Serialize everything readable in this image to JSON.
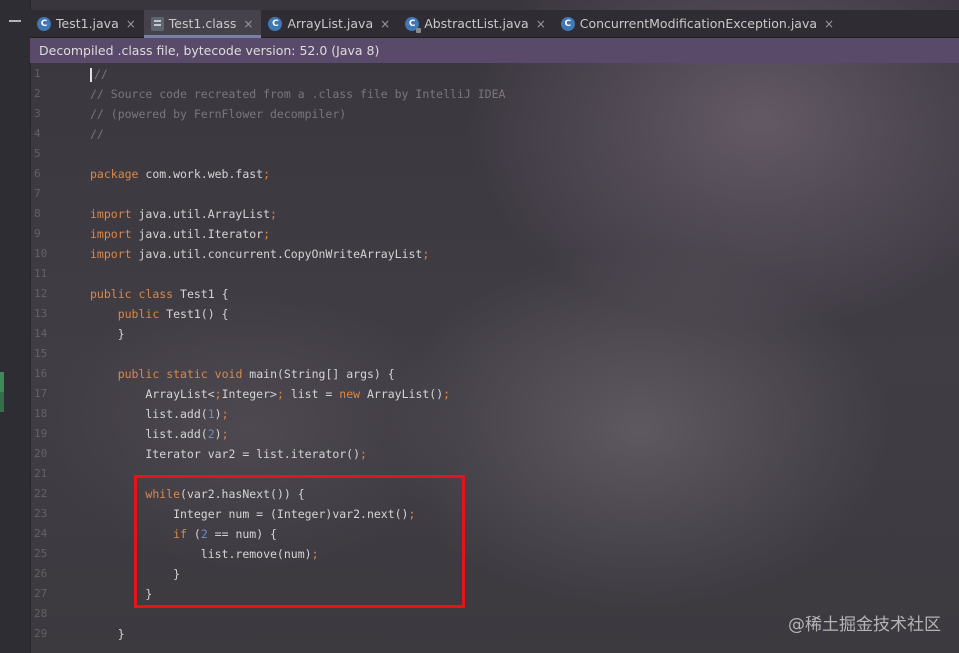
{
  "tabs": [
    {
      "label": "Test1.java",
      "icon": "java-class-icon"
    },
    {
      "label": "Test1.class",
      "icon": "class-file-icon",
      "active": true
    },
    {
      "label": "ArrayList.java",
      "icon": "java-class-icon"
    },
    {
      "label": "AbstractList.java",
      "icon": "abstract-class-icon"
    },
    {
      "label": "ConcurrentModificationException.java",
      "icon": "java-class-icon"
    }
  ],
  "tab_close_glyph": "×",
  "banner": "Decompiled .class file, bytecode version: 52.0 (Java 8)",
  "line_numbers": [
    "1",
    "2",
    "3",
    "4",
    "5",
    "6",
    "7",
    "8",
    "9",
    "10",
    "11",
    "12",
    "13",
    "14",
    "15",
    "16",
    "17",
    "18",
    "19",
    "20",
    "21",
    "22",
    "23",
    "24",
    "25",
    "26",
    "27",
    "28",
    "29"
  ],
  "code_lines": [
    "//",
    "// Source code recreated from a .class file by IntelliJ IDEA",
    "// (powered by FernFlower decompiler)",
    "//",
    "",
    "package com.work.web.fast;",
    "",
    "import java.util.ArrayList;",
    "import java.util.Iterator;",
    "import java.util.concurrent.CopyOnWriteArrayList;",
    "",
    "public class Test1 {",
    "    public Test1() {",
    "    }",
    "",
    "    public static void main(String[] args) {",
    "        ArrayList<Integer> list = new ArrayList();",
    "        list.add(1);",
    "        list.add(2);",
    "        Iterator var2 = list.iterator();",
    "",
    "        while(var2.hasNext()) {",
    "            Integer num = (Integer)var2.next();",
    "            if (2 == num) {",
    "                list.remove(num);",
    "            }",
    "        }",
    "",
    "    }"
  ],
  "watermark": "@稀土掘金技术社区",
  "colors": {
    "keyword": "#d9894a",
    "number": "#6a8ec4",
    "comment": "#8e8e8e",
    "highlight": "#e8121d",
    "banner": "#5a4a6a"
  }
}
